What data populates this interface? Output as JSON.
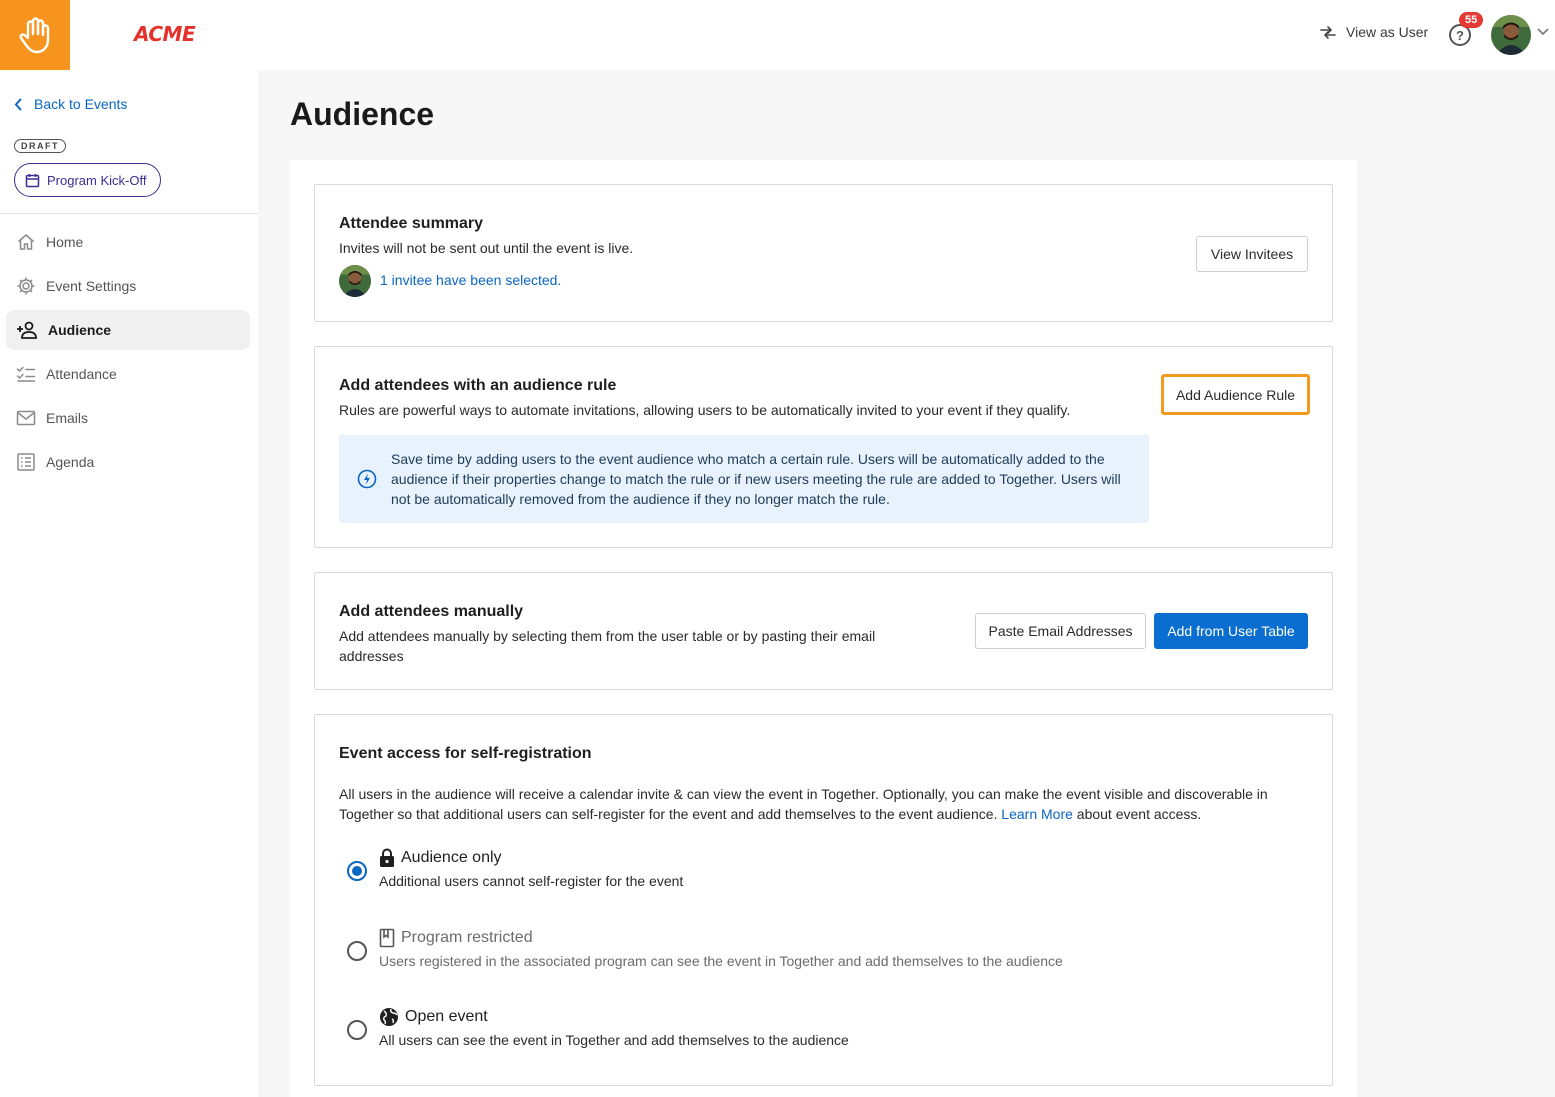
{
  "header": {
    "brand_name": "ACME",
    "view_as_user_label": "View as User",
    "notification_count": "55",
    "help_symbol": "?"
  },
  "sidebar": {
    "back_label": "Back to Events",
    "draft_badge": "DRAFT",
    "event_name": "Program Kick-Off",
    "items": [
      {
        "label": "Home",
        "icon": "home-icon"
      },
      {
        "label": "Event Settings",
        "icon": "gear-icon"
      },
      {
        "label": "Audience",
        "icon": "add-person-icon",
        "active": true
      },
      {
        "label": "Attendance",
        "icon": "checklist-icon"
      },
      {
        "label": "Emails",
        "icon": "mail-icon"
      },
      {
        "label": "Agenda",
        "icon": "list-icon"
      }
    ]
  },
  "main": {
    "title": "Audience",
    "summary": {
      "title": "Attendee summary",
      "subtitle": "Invites will not be sent out until the event is live.",
      "invitee_link": "1 invitee have been selected.",
      "view_button": "View Invitees"
    },
    "rule": {
      "title": "Add attendees with an audience rule",
      "subtitle": "Rules are powerful ways to automate invitations, allowing users to be automatically invited to your event if they qualify.",
      "button": "Add Audience Rule",
      "info": "Save time by adding users to the event audience who match a certain rule. Users will be automatically added to the audience if their properties change to match the rule or if new users meeting the rule are added to Together. Users will not be automatically removed from the audience if they no longer match the rule."
    },
    "manual": {
      "title": "Add attendees manually",
      "subtitle": "Add attendees manually by selecting them from the user table or by pasting their email addresses",
      "paste_button": "Paste Email Addresses",
      "table_button": "Add from User Table"
    },
    "access": {
      "title": "Event access for self-registration",
      "description_before": "All users in the audience will receive a calendar invite & can view the event in Together. Optionally, you can make the event visible and discoverable in Together so that additional users can self-register for the event and add themselves to the event audience.",
      "learn_more": "Learn More",
      "description_after": "about event access.",
      "options": [
        {
          "title": "Audience only",
          "desc": "Additional users cannot self-register for the event",
          "selected": true,
          "icon": "lock-icon"
        },
        {
          "title": "Program restricted",
          "desc": "Users registered in the associated program can see the event in Together and add themselves to the audience",
          "selected": false,
          "disabled": true,
          "icon": "book-icon"
        },
        {
          "title": "Open event",
          "desc": "All users can see the event in Together and add themselves to the audience",
          "selected": false,
          "icon": "globe-icon"
        }
      ]
    }
  },
  "colors": {
    "brand_orange": "#f7941d",
    "acme_red": "#e4312b",
    "link_blue": "#0a66c2",
    "primary_button": "#0a6ed1",
    "focus_outline": "#f39a1e",
    "info_background": "#e8f2fc",
    "badge_red": "#e53935"
  }
}
